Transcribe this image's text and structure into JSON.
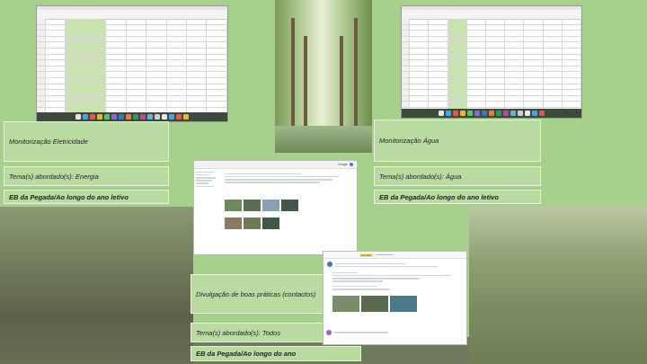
{
  "panels": {
    "electricity": {
      "title": "Monitorização Eletricidade",
      "topic": "Tema(s) abordado(s): Energia",
      "school": "EB da Pegada/Ao longo do ano letivo"
    },
    "water": {
      "title": "Monitorização Água",
      "topic": "Tema(s) abordado(s): Água",
      "school": "EB da Pegada/Ao longo do ano letivo"
    },
    "contacts": {
      "title": "Divulgação de boas práticas (contactos)",
      "topic": "Tema(s) abordado(s): Todos",
      "school": "EB da Pegada/Ao longo do ano"
    }
  },
  "browser": {
    "search_engine": "Google"
  },
  "mail": {
    "badge": "Entrada"
  },
  "colors": {
    "slide_bg": "#a8d08d",
    "panel_bg": "#b9dba2",
    "sheet_green": "#c9e3b0"
  },
  "icons": [
    "spreadsheet-icon",
    "dock-app-icon",
    "google-icon",
    "email-icon",
    "avatar-icon"
  ]
}
